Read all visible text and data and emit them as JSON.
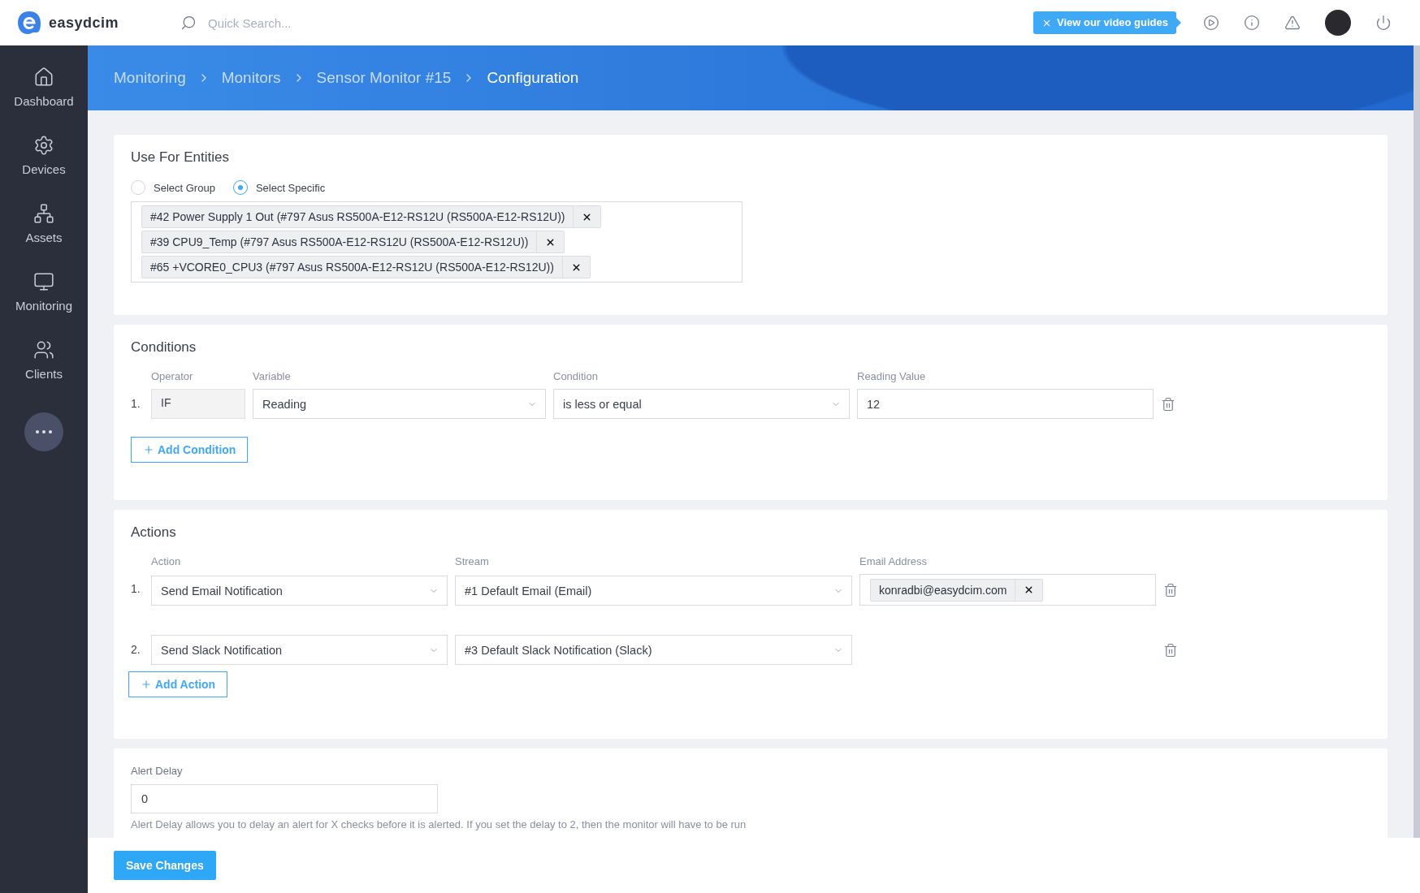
{
  "logo": {
    "text": "easydcim"
  },
  "search": {
    "placeholder": "Quick Search..."
  },
  "guide_tooltip": {
    "text": "View our video guides"
  },
  "sidebar": {
    "items": [
      {
        "label": "Dashboard"
      },
      {
        "label": "Devices"
      },
      {
        "label": "Assets"
      },
      {
        "label": "Monitoring"
      },
      {
        "label": "Clients"
      }
    ]
  },
  "breadcrumb": [
    "Monitoring",
    "Monitors",
    "Sensor Monitor #15",
    "Configuration"
  ],
  "entities": {
    "title": "Use For Entities",
    "options": [
      {
        "label": "Select Group",
        "selected": false
      },
      {
        "label": "Select Specific",
        "selected": true
      }
    ],
    "tags": [
      "#42 Power Supply 1 Out (#797 Asus RS500A-E12-RS12U (RS500A-E12-RS12U))",
      "#39 CPU9_Temp (#797 Asus RS500A-E12-RS12U (RS500A-E12-RS12U))",
      "#65 +VCORE0_CPU3 (#797 Asus RS500A-E12-RS12U (RS500A-E12-RS12U))"
    ]
  },
  "conditions": {
    "title": "Conditions",
    "columns": [
      "Operator",
      "Variable",
      "Condition",
      "Reading Value"
    ],
    "rows": [
      {
        "number": "1.",
        "operator": "IF",
        "variable": "Reading",
        "condition": "is less or equal",
        "reading_value": "12"
      }
    ],
    "add_button": "Add Condition"
  },
  "actions": {
    "title": "Actions",
    "columns": [
      "Action",
      "Stream",
      "Email Address"
    ],
    "rows": [
      {
        "number": "1.",
        "action": "Send Email Notification",
        "stream": "#1 Default Email (Email)",
        "emails": [
          "konradbi@easydcim.com"
        ]
      },
      {
        "number": "2.",
        "action": "Send Slack Notification",
        "stream": "#3 Default Slack Notification (Slack)"
      }
    ],
    "add_button": "Add Action"
  },
  "alert_delay": {
    "label": "Alert Delay",
    "value": "0",
    "help": "Alert Delay allows you to delay an alert for X checks before it is alerted. If you set the delay to 2, then the monitor will have to be run"
  },
  "save_button": "Save Changes"
}
